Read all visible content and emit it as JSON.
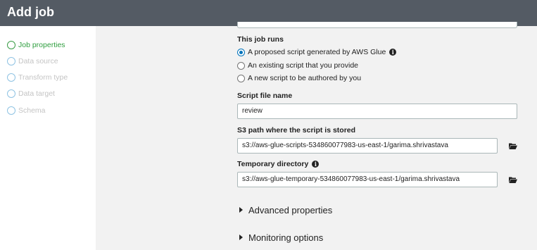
{
  "header": {
    "title": "Add job"
  },
  "sidebar": {
    "steps": [
      {
        "label": "Job properties"
      },
      {
        "label": "Data source"
      },
      {
        "label": "Transform type"
      },
      {
        "label": "Data target"
      },
      {
        "label": "Schema"
      }
    ]
  },
  "form": {
    "job_runs": {
      "label": "This job runs",
      "options": [
        {
          "label": "A proposed script generated by AWS Glue",
          "selected": true
        },
        {
          "label": "An existing script that you provide",
          "selected": false
        },
        {
          "label": "A new script to be authored by you",
          "selected": false
        }
      ]
    },
    "script_file_name": {
      "label": "Script file name",
      "value": "review"
    },
    "s3_path": {
      "label": "S3 path where the script is stored",
      "value": "s3://aws-glue-scripts-534860077983-us-east-1/garima.shrivastava"
    },
    "temp_dir": {
      "label": "Temporary directory",
      "value": "s3://aws-glue-temporary-534860077983-us-east-1/garima.shrivastava"
    },
    "advanced": {
      "label": "Advanced properties"
    },
    "monitoring": {
      "label": "Monitoring options"
    }
  },
  "colors": {
    "header_bg": "#545b64",
    "active_step": "#2f9e3f",
    "radio_selected": "#0073bb"
  }
}
